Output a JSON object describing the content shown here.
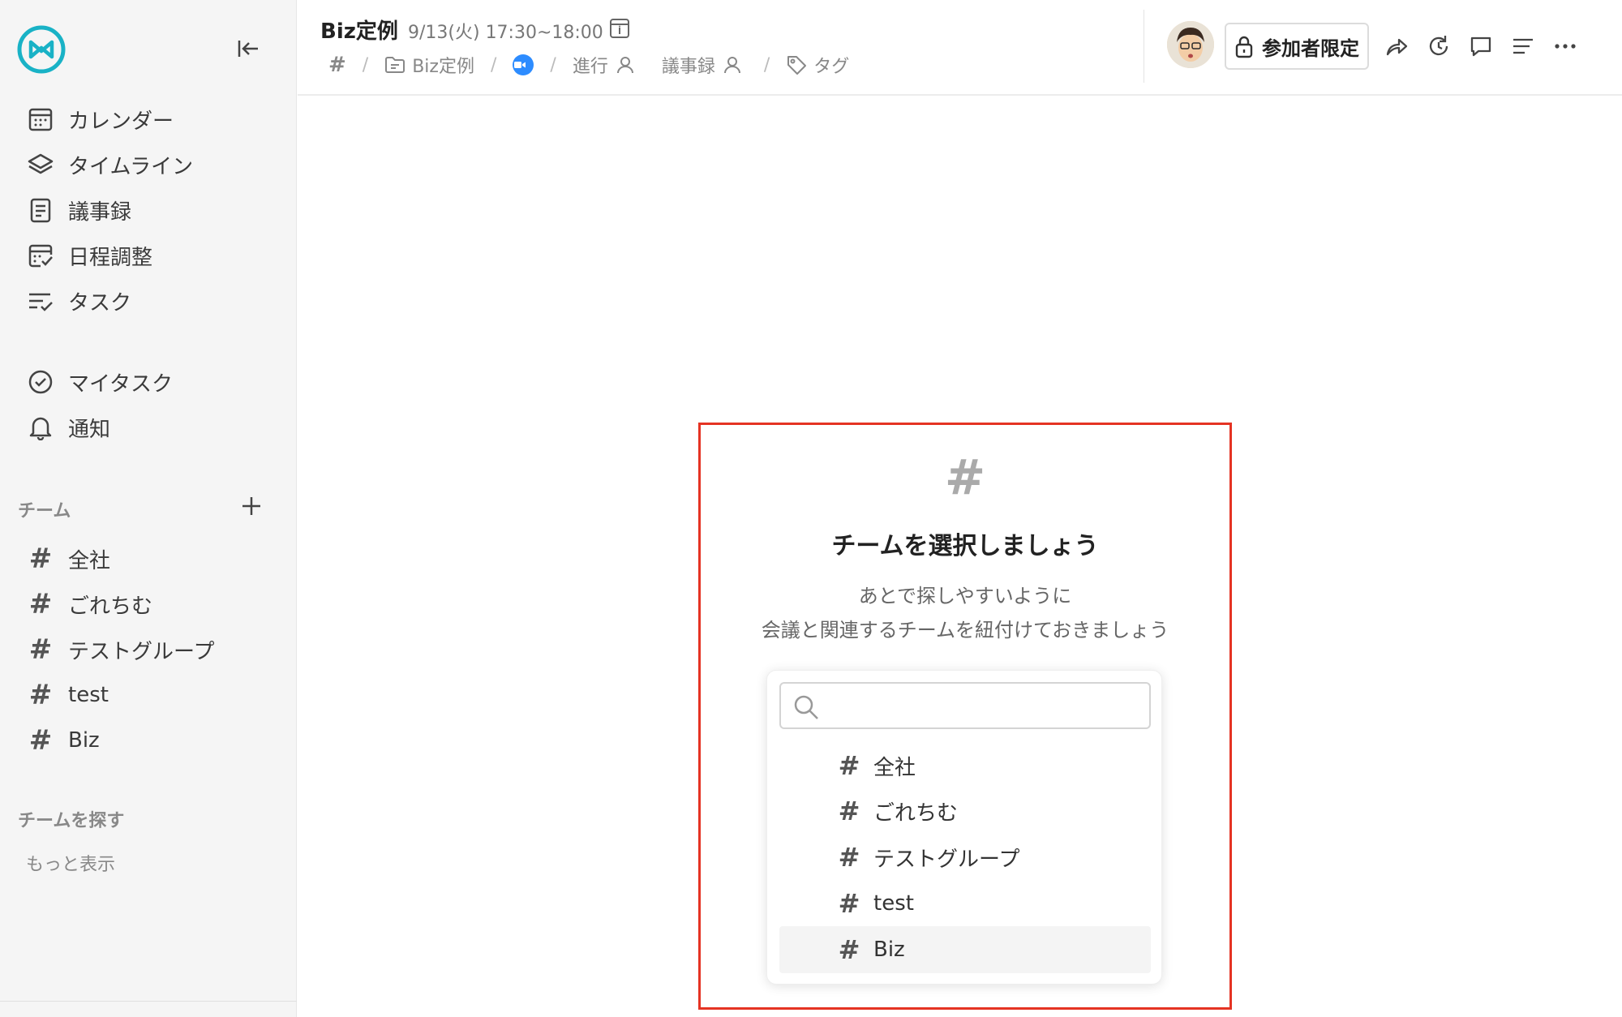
{
  "sidebar": {
    "nav": [
      {
        "label": "カレンダー",
        "icon": "calendar-icon"
      },
      {
        "label": "タイムライン",
        "icon": "layers-icon"
      },
      {
        "label": "議事録",
        "icon": "document-icon"
      },
      {
        "label": "日程調整",
        "icon": "schedule-check-icon"
      },
      {
        "label": "タスク",
        "icon": "task-list-icon"
      }
    ],
    "personal": [
      {
        "label": "マイタスク",
        "icon": "check-circle-icon"
      },
      {
        "label": "通知",
        "icon": "bell-icon"
      }
    ],
    "teams_title": "チーム",
    "teams": [
      "全社",
      "ごれちむ",
      "テストグループ",
      "test",
      "Biz"
    ],
    "find_title": "チームを探す",
    "more_label": "もっと表示"
  },
  "header": {
    "title": "Biz定例",
    "time": "9/13(火) 17:30~18:00",
    "crumbs": {
      "hash": "#",
      "folder": "Biz定例",
      "progress": "進行",
      "minutes": "議事録",
      "tag": "タグ"
    },
    "access_label": "参加者限定"
  },
  "panel": {
    "icon": "#",
    "title": "チームを選択しましょう",
    "desc_line1": "あとで探しやすいように",
    "desc_line2": "会議と関連するチームを紐付けておきましょう",
    "search_value": "",
    "options": [
      "全社",
      "ごれちむ",
      "テストグループ",
      "test",
      "Biz"
    ],
    "selected": "Biz"
  },
  "colors": {
    "accent": "#19b2c6",
    "highlight_border": "#e53323",
    "zoom_blue": "#2d8cff"
  }
}
